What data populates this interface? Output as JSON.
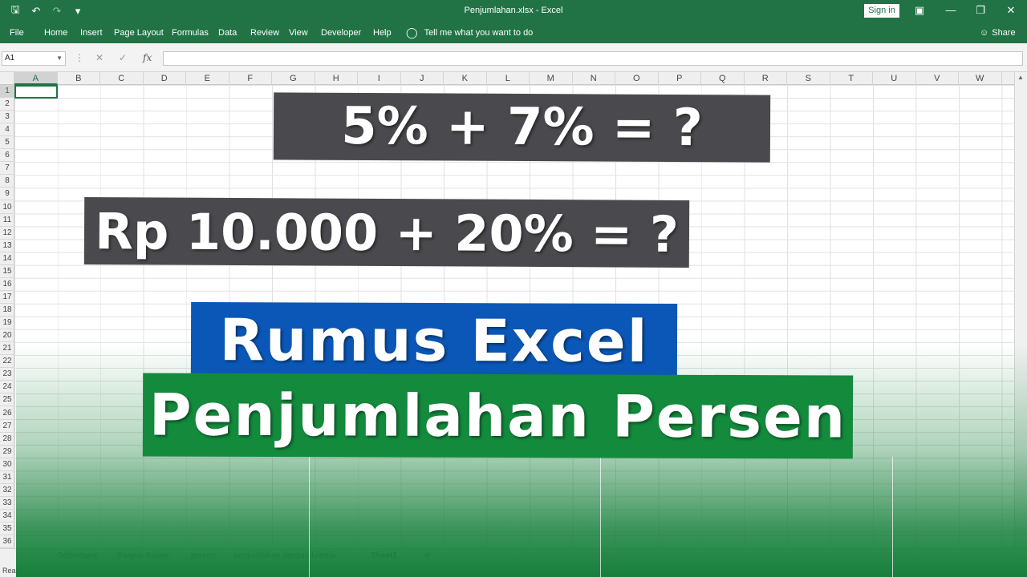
{
  "window": {
    "title": "Penjumlahan.xlsx  -  Excel",
    "signin_label": "Sign in"
  },
  "ribbon": {
    "tabs": [
      "File",
      "Home",
      "Insert",
      "Page Layout",
      "Formulas",
      "Data",
      "Review",
      "View",
      "Developer",
      "Help"
    ],
    "tellme": "Tell me what you want to do",
    "share": "Share"
  },
  "formula_bar": {
    "name_box": "A1",
    "formula": ""
  },
  "grid": {
    "columns": [
      "A",
      "B",
      "C",
      "D",
      "E",
      "F",
      "G",
      "H",
      "I",
      "J",
      "K",
      "L",
      "M",
      "N",
      "O",
      "P",
      "Q",
      "R",
      "S",
      "T",
      "U",
      "V",
      "W"
    ],
    "rows": [
      "1",
      "2",
      "3",
      "4",
      "5",
      "6",
      "7",
      "8",
      "9",
      "10",
      "11",
      "12",
      "13",
      "14",
      "15",
      "16",
      "17",
      "18",
      "19",
      "20",
      "21",
      "22",
      "23",
      "24",
      "25",
      "26",
      "27",
      "28",
      "29",
      "30",
      "31",
      "32",
      "33",
      "34",
      "35",
      "36"
    ],
    "selected_column": "A",
    "selected_row": "1"
  },
  "overlay": {
    "line1": "5% + 7% = ?",
    "line2": "Rp 10.000 + 20% = ?",
    "line3": "Rumus Excel",
    "line4": "Penjumlahan Persen"
  },
  "sheets": {
    "tabs": [
      "Sederhana",
      "Banyak Kolom",
      "persen",
      "penjumlahan dengan kriteria",
      "Sheet1"
    ],
    "active": "Sheet1"
  },
  "status": {
    "text": "Read"
  },
  "colors": {
    "excel_green": "#217346",
    "banner_gray": "#4a4a4e",
    "banner_blue": "#0b57b8",
    "banner_green": "#138a3c"
  }
}
